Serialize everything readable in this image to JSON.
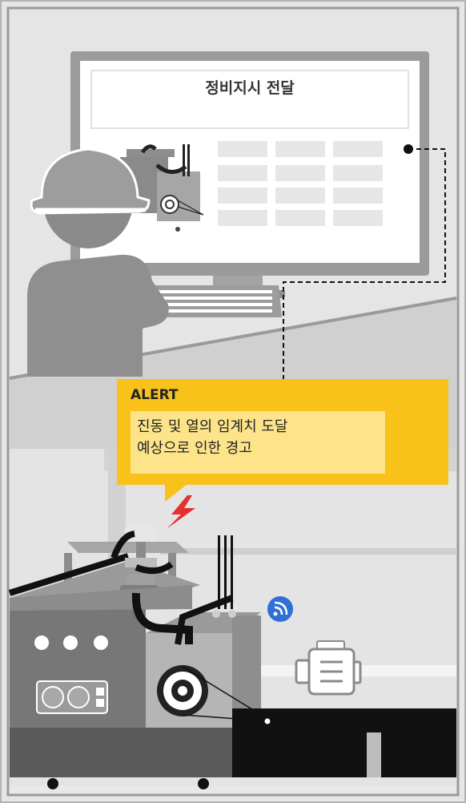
{
  "monitor": {
    "title": "정비지시 전달"
  },
  "alert": {
    "title": "ALERT",
    "message_line1": "진동 및 열의 임계치 도달",
    "message_line2": "예상으로 인한 경고"
  },
  "colors": {
    "alert_background": "#f8c21b",
    "alert_message_background": "#fde48a",
    "wireless_icon": "#2f6fd6",
    "lightning_icon": "#e53030"
  }
}
